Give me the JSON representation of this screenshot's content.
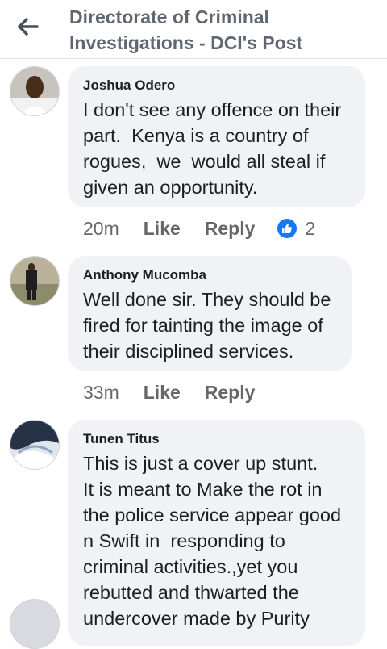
{
  "header": {
    "title": "Directorate of Criminal Investigations - DCI's Post"
  },
  "comments": [
    {
      "author": "Joshua Odero",
      "text": "I don't see any offence on their part.  Kenya is a country of rogues,  we  would all steal if given an opportunity.",
      "time": "20m",
      "like_label": "Like",
      "reply_label": "Reply",
      "reaction_count": "2"
    },
    {
      "author": "Anthony Mucomba",
      "text": "Well done sir. They should be fired for tainting the image of their disciplined services.",
      "time": "33m",
      "like_label": "Like",
      "reply_label": "Reply"
    },
    {
      "author": "Tunen Titus",
      "text": "This is just a cover up stunt.\nIt is meant to Make the rot in the police service appear good n Swift in  responding to criminal activities.,yet you rebutted and thwarted the undercover made by Purity"
    }
  ],
  "icons": {
    "back": "arrow-left-icon",
    "reaction": "thumbs-up-icon"
  },
  "colors": {
    "bubble": "#f0f2f5",
    "accent": "#1877f2",
    "muted": "#65676b"
  }
}
